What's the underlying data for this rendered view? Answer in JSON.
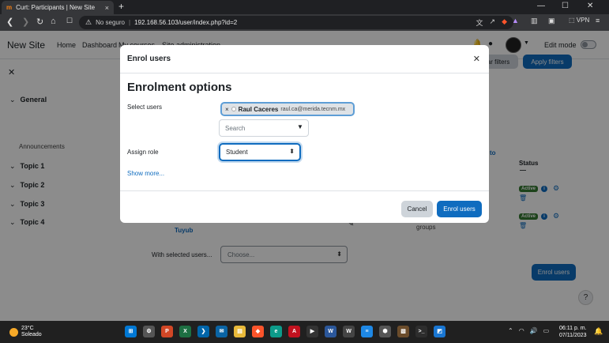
{
  "browser": {
    "tab_title": "Curt: Participants | New Site",
    "tab_favicon": "m",
    "tab_close": "×",
    "new_tab": "+",
    "security_label": "No seguro",
    "url": "192.168.56.103/user/index.php?id=2",
    "vpn": "VPN",
    "window_controls": [
      "—",
      "☐",
      "✕"
    ]
  },
  "site": {
    "brand": "New Site",
    "nav": [
      "Home",
      "Dashboard",
      "My courses",
      "Site administration"
    ],
    "edit_mode_label": "Edit mode"
  },
  "drawer": {
    "sections": [
      {
        "label": "General"
      },
      {
        "label": "Topic 1"
      },
      {
        "label": "Topic 2"
      },
      {
        "label": "Topic 3"
      },
      {
        "label": "Topic 4"
      }
    ],
    "sub_item": "Announcements"
  },
  "background": {
    "filter_button": "Apply filters",
    "clear_filters": "Clear filters",
    "status_header": "Status",
    "status_dash": "—",
    "active_badge": "Active",
    "partial_col": "to",
    "student_name": "Tuyub",
    "groups_label": "groups",
    "with_selected_label": "With selected users...",
    "choose_placeholder": "Choose...",
    "enrol_button": "Enrol users",
    "help": "?"
  },
  "modal": {
    "title": "Enrol users",
    "heading": "Enrolment options",
    "select_users_label": "Select users",
    "selected_user": {
      "name": "Raul Caceres",
      "email": "raul.ca@merida.tecnm.mx"
    },
    "search_placeholder": "Search",
    "assign_role_label": "Assign role",
    "role_value": "Student",
    "show_more": "Show more...",
    "cancel": "Cancel",
    "submit": "Enrol users"
  },
  "taskbar": {
    "temperature": "23°C",
    "weather": "Soleado",
    "time": "06:11 p. m.",
    "date": "07/11/2023"
  },
  "colors": {
    "primary": "#0f6cbf",
    "success": "#357a32",
    "moodle_orange": "#f98012"
  }
}
